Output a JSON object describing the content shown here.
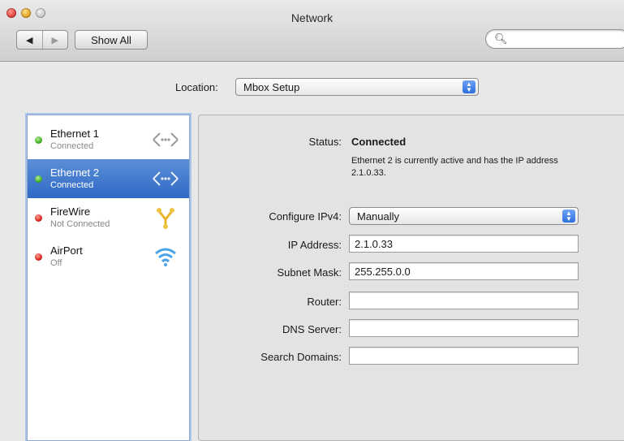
{
  "window": {
    "title": "Network"
  },
  "toolbar": {
    "back": "◀",
    "forward": "▶",
    "show_all": "Show All",
    "search_placeholder": ""
  },
  "location": {
    "label": "Location:",
    "value": "Mbox Setup"
  },
  "sidebar": {
    "items": [
      {
        "name": "Ethernet 1",
        "status": "Connected",
        "dot": "#3fae24",
        "icon": "ethernet-icon"
      },
      {
        "name": "Ethernet 2",
        "status": "Connected",
        "dot": "#3fae24",
        "icon": "ethernet-icon",
        "selected": true
      },
      {
        "name": "FireWire",
        "status": "Not Connected",
        "dot": "#d6261c",
        "icon": "firewire-icon"
      },
      {
        "name": "AirPort",
        "status": "Off",
        "dot": "#d6261c",
        "icon": "wifi-icon"
      }
    ]
  },
  "detail": {
    "status_label": "Status:",
    "status_value": "Connected",
    "status_note": "Ethernet 2 is currently active and has the IP address 2.1.0.33.",
    "configure_label": "Configure IPv4:",
    "configure_value": "Manually",
    "ip_label": "IP Address:",
    "ip_value": "2.1.0.33",
    "subnet_label": "Subnet Mask:",
    "subnet_value": "255.255.0.0",
    "router_label": "Router:",
    "router_value": "",
    "dns_label": "DNS Server:",
    "dns_value": "",
    "search_label": "Search Domains:",
    "search_value": ""
  },
  "colors": {
    "selection": "#2f69c6",
    "connected": "#3fae24",
    "disconnected": "#d6261c"
  }
}
